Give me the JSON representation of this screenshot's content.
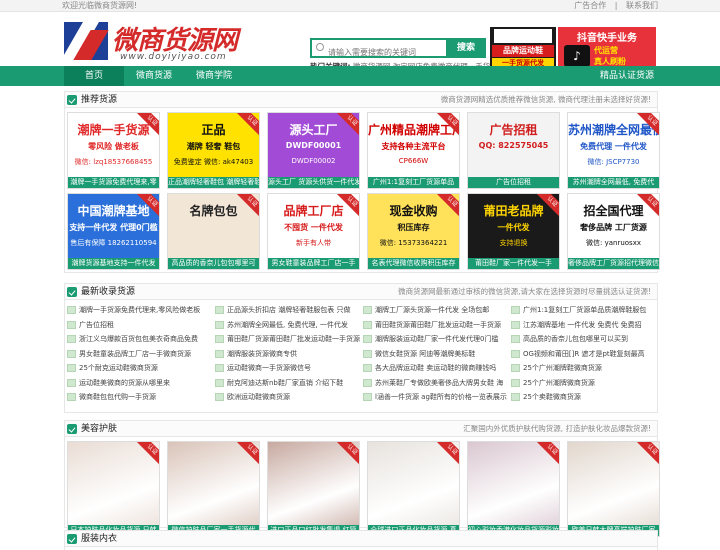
{
  "topbar": {
    "welcome": "欢迎光临微商货源网!",
    "links": [
      "广告合作",
      "联系我们"
    ]
  },
  "logo": {
    "title": "微商货源网",
    "domain": "www.doyiyiyao.com"
  },
  "search": {
    "placeholder": "请输入需要搜索的关键词",
    "button": "搜索",
    "hot_label": "热门关键词:",
    "hot_text": "微商货源网 淘宝网店免费微商代理一手货源"
  },
  "ads": {
    "ad1_l1": "品牌运动鞋",
    "ad1_l2": "一手货源代发",
    "ad2_title": "抖音快手业务",
    "ad2_l1": "代运营",
    "ad2_l2": "真人刷粉"
  },
  "nav": {
    "items": [
      "首页",
      "微商货源",
      "微商学院"
    ],
    "right": "精品认证货源"
  },
  "recommend": {
    "title": "推荐货源",
    "desc": "微商货源网精选优质推荐微信货源, 微商代理注册未选择好货源!",
    "badge": "认证",
    "cards": [
      {
        "big": "潮牌一手货源",
        "l1": "零风险 做老板",
        "l2": "微信: lzq18537668455",
        "cap": "潮牌一手货源免费代理来,零",
        "bg": "#ffffff",
        "fg": "#e02828"
      },
      {
        "big": "正品",
        "l1": "潮牌 轻奢 鞋包",
        "l2": "免费鉴定 微信: ak47403",
        "cap": "正品潮牌轻奢鞋包 潮牌轻奢鞋",
        "bg": "#ffe200",
        "fg": "#111111"
      },
      {
        "big": "源头工厂",
        "l1": "DWDF00001",
        "l2": "DWDF00002",
        "cap": "源头工厂 货源头供货一件代发",
        "bg": "#a24bd6",
        "fg": "#ffffff"
      },
      {
        "big": "广州精品潮牌工厂货源",
        "l1": "支持各种主流平台",
        "l2": "CP666W",
        "cap": "广州1:1复刻工厂货源单品",
        "bg": "#ffffff",
        "fg": "#d10000"
      },
      {
        "big": "广告招租",
        "l1": "QQ: 822575045",
        "l2": "",
        "cap": "广告位招租",
        "bg": "#f3f3f3",
        "fg": "#d11f1f"
      },
      {
        "big": "苏州潮牌全网最低",
        "l1": "免费代理 一件代发",
        "l2": "微信: JSCP7730",
        "cap": "苏州潮牌全网最低, 免费代",
        "bg": "#ffffff",
        "fg": "#1f56c7"
      },
      {
        "big": "中国潮牌基地",
        "l1": "支持一件代发 代理0门槛",
        "l2": "售后有保障 18262110594",
        "cap": "潮牌货源基地支持一件代发",
        "bg": "#2a6fda",
        "fg": "#ffffff"
      },
      {
        "big": "名牌包包",
        "l1": "",
        "l2": "",
        "cap": "高品质的香奈儿包包哪里可",
        "bg": "#f2e6d7",
        "fg": "#222222"
      },
      {
        "big": "品牌工厂店",
        "l1": "不囤货 一件代发",
        "l2": "新手有人带",
        "cap": "男女鞋童装品牌工厂店一手",
        "bg": "#ffffff",
        "fg": "#d71b1b"
      },
      {
        "big": "现金收购",
        "l1": "积压库存",
        "l2": "微信: 15373364221",
        "cap": "名表代理微信收购积压库存",
        "bg": "#ffe25a",
        "fg": "#111111"
      },
      {
        "big": "莆田老品牌",
        "l1": "一件代发",
        "l2": "支持退换",
        "cap": "莆田鞋厂家一件代发一手",
        "bg": "#1a1a1a",
        "fg": "#ffd400"
      },
      {
        "big": "招全国代理",
        "l1": "奢侈品牌 工厂货源",
        "l2": "微信: yanruosxx",
        "cap": "奢侈品牌工厂货源招代理微信",
        "bg": "#ffffff",
        "fg": "#111111"
      }
    ]
  },
  "latest": {
    "title": "最新收录货源",
    "desc": "微商货源网最新通过审核的微信货源,请大家在选择货源时尽量挑选认证货源!",
    "items": [
      "潮牌一手货源免费代理来,零风险做老板",
      "正品源头折扣店 潮牌轻奢鞋服包表 只做",
      "潮牌工厂源头货源一件代发 全场包邮",
      "广州1:1复刻工厂货源单品质潮牌鞋服包",
      "广告位招租",
      "苏州潮牌全网最低, 免费代理, 一件代发",
      "莆田鞋货源莆田鞋厂批发运动鞋一手货源",
      "江苏潮牌基地 一件代发 免费代 免费招",
      "浙江义乌爆款百货包包美衣奇商品免费",
      "莆田鞋厂货源莆田鞋厂批发运动鞋一手货源",
      "潮牌服装运动鞋厂家一件代发代理0门槛",
      "高品质的香奈儿包包哪里可以买到",
      "男女鞋童装品牌工厂店一手微商货源",
      "潮牌服装货源微商专供",
      "微信女鞋货源 阿迪等潮牌美标鞋",
      "OG视频和莆田[]R 遮才是pt鞋复刻最高",
      "25个耐克运动鞋微商货源",
      "运动鞋微商一手货源微信号",
      "各大品牌运动鞋 卖运动鞋的微商赚钱吗",
      "25个广州潮牌鞋微商货源",
      "运动鞋美微商的货源从哪里来",
      "耐克阿迪达斯nb鞋厂家直销 介绍下鞋",
      "苏州莱鞋厂专做欧美奢侈品大牌男女鞋 海",
      "25个广州潮牌微商货源",
      "微商鞋包包代购一手货源",
      "欧洲运动鞋微商货源",
      "l涵善一件货源 ag鞋所有的价格一览表展示",
      "25个卖鞋微商货源"
    ]
  },
  "beauty": {
    "title": "美容护肤",
    "desc": "汇聚国内外优质护肤代购货源, 打造护肤化妆品爆款货源!",
    "caps": [
      "日本护肤品化妆品货源 日韩",
      "微信护肤品厂家一手货源代",
      "进口正品口红批发集退 红管",
      "全球进口正品化妆品货源,真",
      "初心彩妆香港化妆品货源彩妆",
      "欧美日韩大牌高端护肤厂家"
    ]
  },
  "clothing": {
    "title": "服装内衣"
  }
}
